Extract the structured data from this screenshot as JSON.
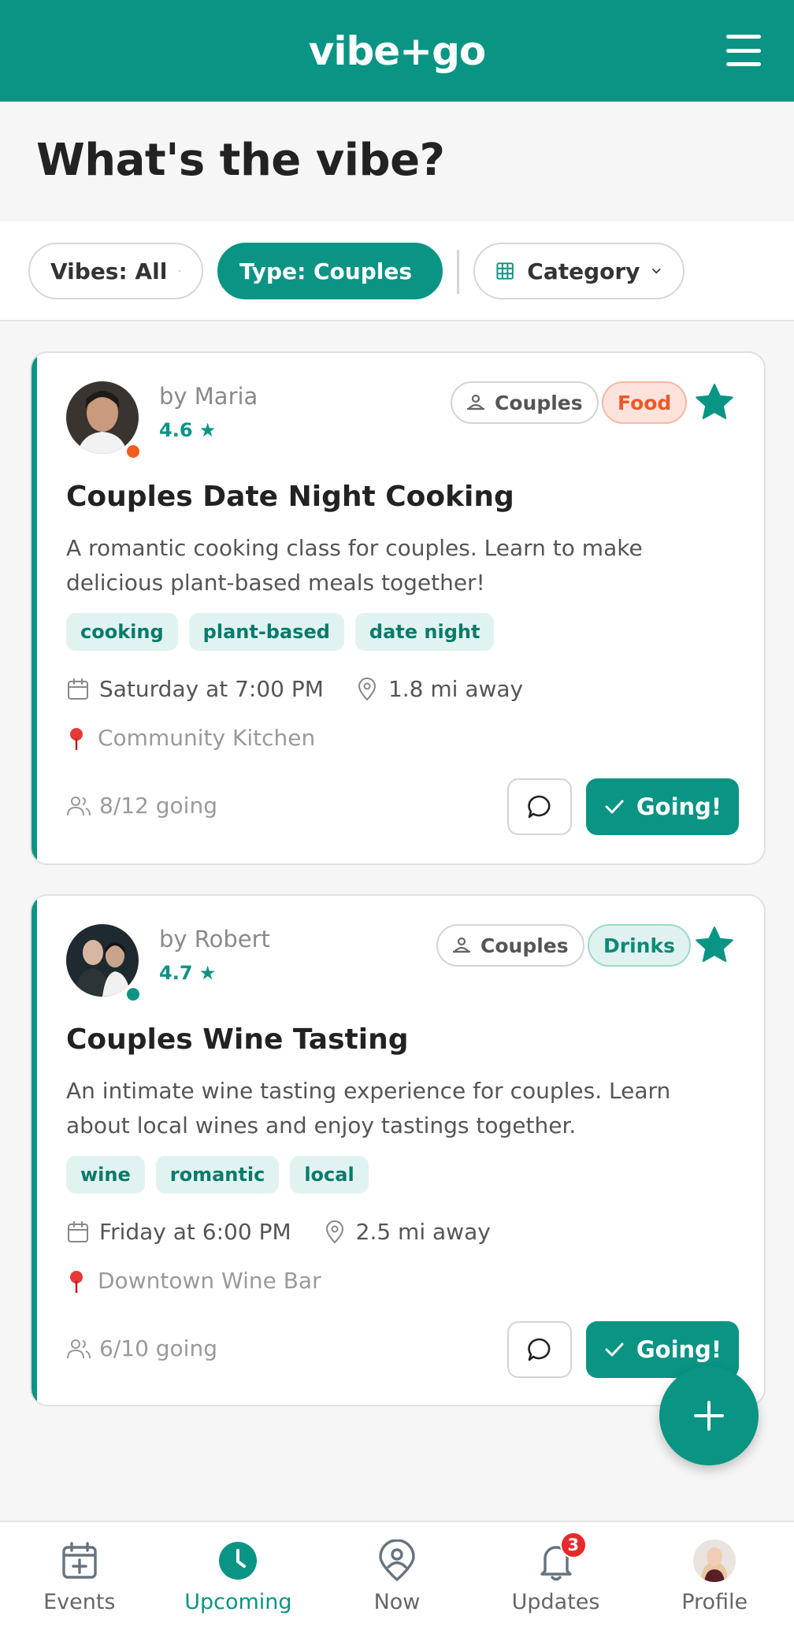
{
  "header": {
    "logo_text": "vibe+go",
    "menu_icon": "hamburger-icon"
  },
  "page": {
    "title": "What's the vibe?"
  },
  "filters": {
    "vibes_label": "Vibes: All",
    "type_label": "Type: Couples",
    "category_label": "Category"
  },
  "events": [
    {
      "author": "by Maria",
      "rating": "4.6 ★",
      "status_color": "#f25a22",
      "type_tag": "Couples",
      "category_tag": "Food",
      "title": "Couples Date Night Cooking",
      "description": "A romantic cooking class for couples. Learn to make delicious plant-based meals together!",
      "tags": [
        "cooking",
        "plant-based",
        "date night"
      ],
      "when": "Saturday at 7:00 PM",
      "distance": "1.8 mi away",
      "location": "Community Kitchen",
      "going_count": "8/12 going",
      "going_label": "Going!"
    },
    {
      "author": "by Robert",
      "rating": "4.7 ★",
      "status_color": "#0a9484",
      "type_tag": "Couples",
      "category_tag": "Drinks",
      "title": "Couples Wine Tasting",
      "description": "An intimate wine tasting experience for couples. Learn about local wines and enjoy tastings together.",
      "tags": [
        "wine",
        "romantic",
        "local"
      ],
      "when": "Friday at 6:00 PM",
      "distance": "2.5 mi away",
      "location": "Downtown Wine Bar",
      "going_count": "6/10 going",
      "going_label": "Going!"
    }
  ],
  "nav": {
    "items": [
      {
        "label": "Events",
        "icon": "calendar-plus-icon"
      },
      {
        "label": "Upcoming",
        "icon": "clock-icon"
      },
      {
        "label": "Now",
        "icon": "location-user-icon"
      },
      {
        "label": "Updates",
        "icon": "bell-icon"
      },
      {
        "label": "Profile",
        "icon": "avatar"
      }
    ],
    "updates_badge": "3",
    "active": "Upcoming"
  },
  "colors": {
    "brand": "#0a9484",
    "food_tag": "#ea5a2a",
    "badge": "#e8292c"
  }
}
